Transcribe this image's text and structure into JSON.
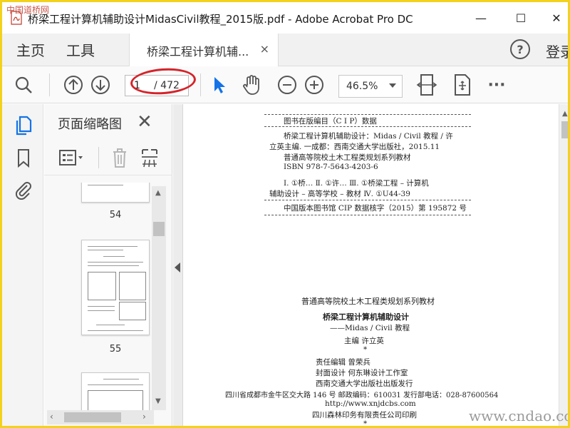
{
  "window": {
    "title": "桥梁工程计算机辅助设计MidasCivil教程_2015版.pdf - Adobe Acrobat Pro DC",
    "minimize": "—",
    "maximize": "☐",
    "close": "✕"
  },
  "nav": {
    "home": "主页",
    "tools": "工具",
    "doc_tab": "桥梁工程计算机辅...",
    "doc_tab_close": "×",
    "help": "?",
    "login": "登录"
  },
  "toolbar": {
    "page_current": "1",
    "page_total": "/ 472",
    "zoom": "46.5%",
    "more": "···"
  },
  "panel": {
    "title": "页面缩略图",
    "close": "✕",
    "thumbnails": [
      {
        "label": "54"
      },
      {
        "label": "55"
      },
      {
        "label": ""
      }
    ]
  },
  "document": {
    "cip_header": "图书在版编目（C I P）数据",
    "cip_lines": [
      "桥梁工程计算机辅助设计：Midas / Civil 教程 / 许",
      "立英主编. 一成都：西南交通大学出版社，2015.11",
      "普通高等院校土木工程类规划系列教材",
      "ISBN 978-7-5643-4203-6",
      "Ⅰ. ①桥… Ⅱ. ①许… Ⅲ. ①桥梁工程 – 计算机",
      "辅助设计 – 高等学校 – 教材  Ⅳ. ①U44-39",
      "中国版本图书馆 CIP 数据核字（2015）第 195872 号"
    ],
    "series": "普通高等院校土木工程类规划系列教材",
    "book_title": "桥梁工程计算机辅助设计",
    "book_subtitle": "——Midas / Civil 教程",
    "editor": "主编    许立英",
    "star": "*",
    "credits": [
      "责任编辑   曾荣兵",
      "封面设计   何东琳设计工作室",
      "西南交通大学出版社出版发行"
    ],
    "address": "四川省成都市金牛区交大路 146 号    邮政编码：610031    发行部电话：028-87600564",
    "website": "http://www.xnjdcbs.com",
    "printer": "四川森林印务有限责任公司印刷",
    "star2": "*"
  },
  "watermarks": {
    "top_left": "中国道桥网",
    "bottom_right": "www.cndao.com"
  },
  "colors": {
    "annotation": "#d4242a",
    "accent_blue": "#1473e6",
    "frame": "#f2d21c"
  }
}
